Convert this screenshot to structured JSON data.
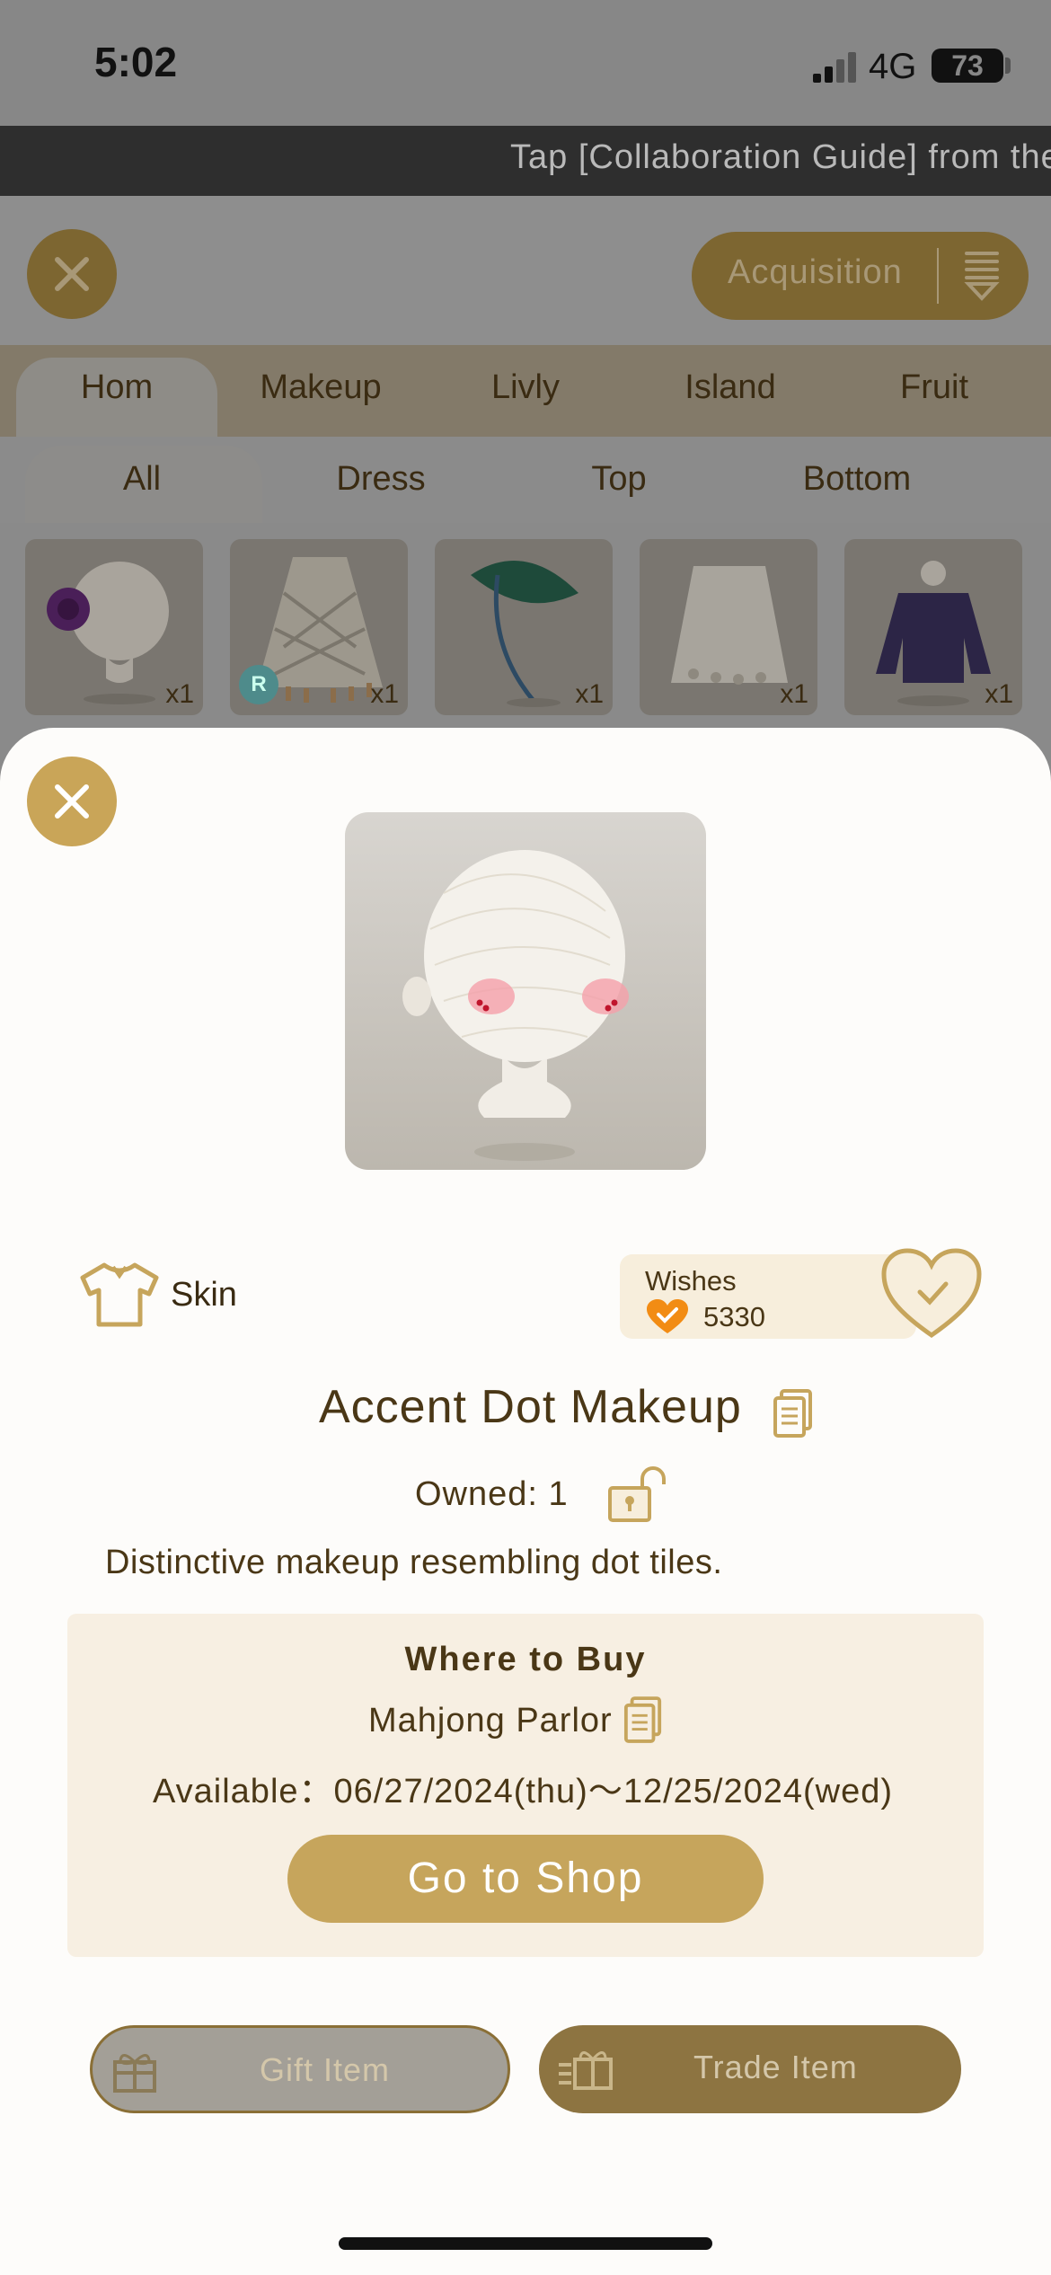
{
  "status_bar": {
    "time": "5:02",
    "network": "4G",
    "battery": "73"
  },
  "ticker": {
    "text": "Tap [Collaboration Guide] from the"
  },
  "header": {
    "acquisition_label": "Acquisition"
  },
  "category_tabs": [
    "Hom",
    "Makeup",
    "Livly",
    "Island",
    "Fruit"
  ],
  "sub_tabs": [
    "All",
    "Dress",
    "Top",
    "Bottom"
  ],
  "items": [
    {
      "qty": "x1",
      "icon": "rose-head-icon"
    },
    {
      "qty": "x1",
      "icon": "tassel-skirt-icon",
      "badge": "R"
    },
    {
      "qty": "x1",
      "icon": "leaf-icon"
    },
    {
      "qty": "x1",
      "icon": "lace-skirt-icon"
    },
    {
      "qty": "x1",
      "icon": "navy-top-icon"
    }
  ],
  "detail": {
    "category": "Skin",
    "wishes_label": "Wishes",
    "wishes_count": "5330",
    "name": "Accent Dot Makeup",
    "owned": "Owned: 1",
    "description": "Distinctive makeup resembling dot tiles.",
    "where_to_buy": {
      "title": "Where to Buy",
      "shop": "Mahjong Parlor",
      "available": "Available：06/27/2024(thu)～12/25/2024(wed)",
      "go_button": "Go to Shop"
    },
    "gift_button": "Gift Item",
    "trade_button": "Trade Item"
  },
  "colors": {
    "gold": "#c6a55c",
    "brown_text": "#4a3716",
    "panel": "#f7efe2"
  }
}
